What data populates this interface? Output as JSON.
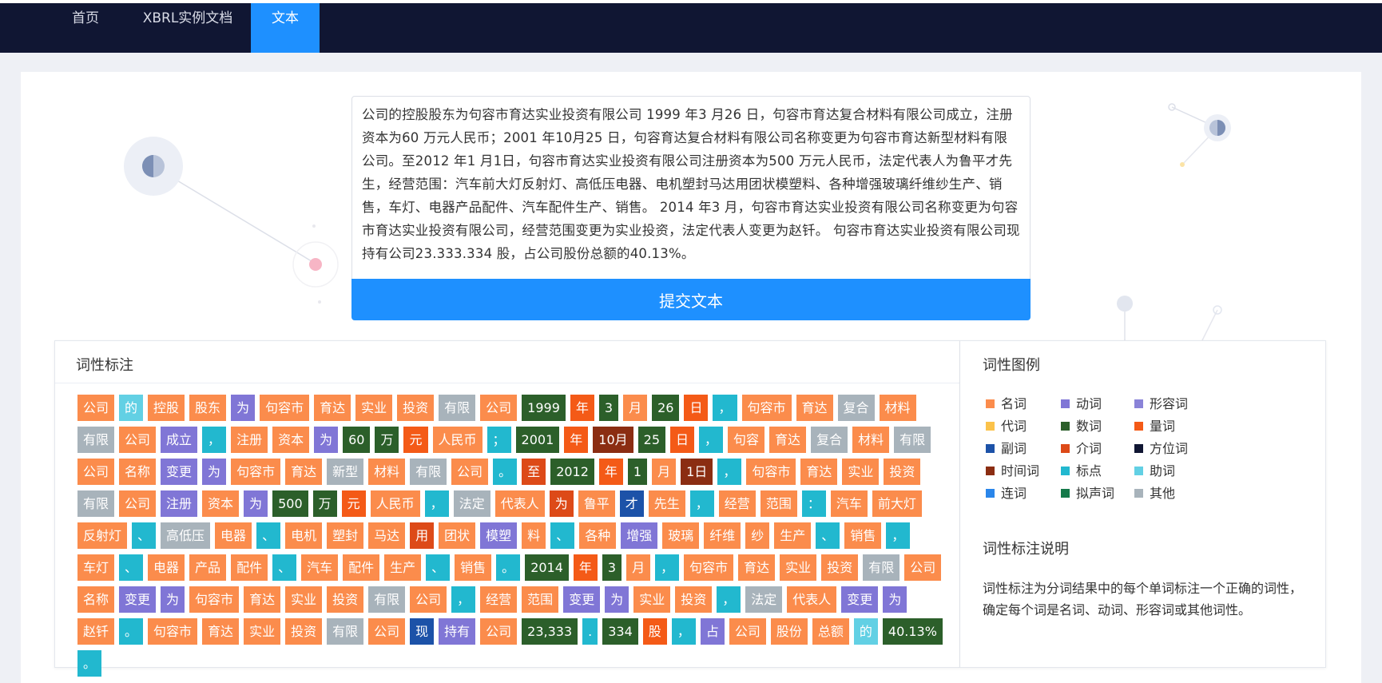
{
  "nav": {
    "items": [
      {
        "label": "首页"
      },
      {
        "label": "XBRL实例文档"
      },
      {
        "label": "文本"
      }
    ]
  },
  "input": {
    "text": "公司的控股股东为句容市育达实业投资有限公司 1999 年3 月26 日，句容市育达复合材料有限公司成立，注册资本为60 万元人民币；2001 年10月25 日，句容育达复合材料有限公司名称变更为句容市育达新型材料有限公司。至2012 年1 月1日，句容市育达实业投资有限公司注册资本为500 万元人民币，法定代表人为鲁平才先生，经营范围：汽车前大灯反射灯、高低压电器、电机塑封马达用团状模塑料、各种增强玻璃纤维纱生产、销售，车灯、电器产品配件、汽车配件生产、销售。 2014 年3 月，句容市育达实业投资有限公司名称变更为句容市育达实业投资有限公司，经营范围变更为实业投资，法定代表人变更为赵钎。 句容市育达实业投资有限公司现持有公司23.333.334 股，占公司股份总额的40.13%。"
  },
  "submit": {
    "label": "提交文本"
  },
  "pos_panel": {
    "title": "词性标注"
  },
  "legend_panel": {
    "title": "词性图例",
    "desc_title": "词性标注说明",
    "desc": "词性标注为分词结果中的每个单词标注一个正确的词性，确定每个词是名词、动词、形容词或其他词性。"
  },
  "colors": {
    "n": "#fb8c4c",
    "v": "#8076d6",
    "a": "#8a83d8",
    "r": "#fbc24a",
    "m": "#2c5f2a",
    "q": "#f45a17",
    "d": "#1c52a8",
    "p": "#dd4a18",
    "f": "#101633",
    "t": "#8b2d12",
    "w": "#22b8cf",
    "u": "#62d0e4",
    "c": "#2a86ea",
    "o": "#15794a",
    "x": "#a8b3bb"
  },
  "legend": [
    {
      "key": "n",
      "label": "名词"
    },
    {
      "key": "v",
      "label": "动词"
    },
    {
      "key": "a",
      "label": "形容词"
    },
    {
      "key": "r",
      "label": "代词"
    },
    {
      "key": "m",
      "label": "数词"
    },
    {
      "key": "q",
      "label": "量词"
    },
    {
      "key": "d",
      "label": "副词"
    },
    {
      "key": "p",
      "label": "介词"
    },
    {
      "key": "f",
      "label": "方位词"
    },
    {
      "key": "t",
      "label": "时间词"
    },
    {
      "key": "w",
      "label": "标点"
    },
    {
      "key": "u",
      "label": "助词"
    },
    {
      "key": "c",
      "label": "连词"
    },
    {
      "key": "o",
      "label": "拟声词"
    },
    {
      "key": "x",
      "label": "其他"
    }
  ],
  "tokens": [
    {
      "text": "公司",
      "pos": "n"
    },
    {
      "text": "的",
      "pos": "u"
    },
    {
      "text": "控股",
      "pos": "n"
    },
    {
      "text": "股东",
      "pos": "n"
    },
    {
      "text": "为",
      "pos": "v"
    },
    {
      "text": "句容市",
      "pos": "n"
    },
    {
      "text": "育达",
      "pos": "n"
    },
    {
      "text": "实业",
      "pos": "n"
    },
    {
      "text": "投资",
      "pos": "n"
    },
    {
      "text": "有限",
      "pos": "x"
    },
    {
      "text": "公司",
      "pos": "n"
    },
    {
      "text": "1999",
      "pos": "m"
    },
    {
      "text": "年",
      "pos": "q"
    },
    {
      "text": "3",
      "pos": "m"
    },
    {
      "text": "月",
      "pos": "n"
    },
    {
      "text": "26",
      "pos": "m"
    },
    {
      "text": "日",
      "pos": "q"
    },
    {
      "text": "，",
      "pos": "w"
    },
    {
      "text": "句容市",
      "pos": "n"
    },
    {
      "text": "育达",
      "pos": "n"
    },
    {
      "text": "复合",
      "pos": "x"
    },
    {
      "text": "材料",
      "pos": "n"
    },
    {
      "text": "有限",
      "pos": "x"
    },
    {
      "text": "公司",
      "pos": "n"
    },
    {
      "text": "成立",
      "pos": "v"
    },
    {
      "text": "，",
      "pos": "w"
    },
    {
      "text": "注册",
      "pos": "n"
    },
    {
      "text": "资本",
      "pos": "n"
    },
    {
      "text": "为",
      "pos": "v"
    },
    {
      "text": "60",
      "pos": "m"
    },
    {
      "text": "万",
      "pos": "m"
    },
    {
      "text": "元",
      "pos": "q"
    },
    {
      "text": "人民币",
      "pos": "n"
    },
    {
      "text": "；",
      "pos": "w"
    },
    {
      "text": "2001",
      "pos": "m"
    },
    {
      "text": "年",
      "pos": "q"
    },
    {
      "text": "10月",
      "pos": "t"
    },
    {
      "text": "25",
      "pos": "m"
    },
    {
      "text": "日",
      "pos": "q"
    },
    {
      "text": "，",
      "pos": "w"
    },
    {
      "text": "句容",
      "pos": "n"
    },
    {
      "text": "育达",
      "pos": "n"
    },
    {
      "text": "复合",
      "pos": "x"
    },
    {
      "text": "材料",
      "pos": "n"
    },
    {
      "text": "有限",
      "pos": "x"
    },
    {
      "text": "公司",
      "pos": "n"
    },
    {
      "text": "名称",
      "pos": "n"
    },
    {
      "text": "变更",
      "pos": "v"
    },
    {
      "text": "为",
      "pos": "v"
    },
    {
      "text": "句容市",
      "pos": "n"
    },
    {
      "text": "育达",
      "pos": "n"
    },
    {
      "text": "新型",
      "pos": "x"
    },
    {
      "text": "材料",
      "pos": "n"
    },
    {
      "text": "有限",
      "pos": "x"
    },
    {
      "text": "公司",
      "pos": "n"
    },
    {
      "text": "。",
      "pos": "w"
    },
    {
      "text": "至",
      "pos": "p"
    },
    {
      "text": "2012",
      "pos": "m"
    },
    {
      "text": "年",
      "pos": "q"
    },
    {
      "text": "1",
      "pos": "m"
    },
    {
      "text": "月",
      "pos": "n"
    },
    {
      "text": "1日",
      "pos": "t"
    },
    {
      "text": "，",
      "pos": "w"
    },
    {
      "text": "句容市",
      "pos": "n"
    },
    {
      "text": "育达",
      "pos": "n"
    },
    {
      "text": "实业",
      "pos": "n"
    },
    {
      "text": "投资",
      "pos": "n"
    },
    {
      "text": "有限",
      "pos": "x"
    },
    {
      "text": "公司",
      "pos": "n"
    },
    {
      "text": "注册",
      "pos": "v"
    },
    {
      "text": "资本",
      "pos": "n"
    },
    {
      "text": "为",
      "pos": "v"
    },
    {
      "text": "500",
      "pos": "m"
    },
    {
      "text": "万",
      "pos": "m"
    },
    {
      "text": "元",
      "pos": "q"
    },
    {
      "text": "人民币",
      "pos": "n"
    },
    {
      "text": "，",
      "pos": "w"
    },
    {
      "text": "法定",
      "pos": "x"
    },
    {
      "text": "代表人",
      "pos": "n"
    },
    {
      "text": "为",
      "pos": "p"
    },
    {
      "text": "鲁平",
      "pos": "n"
    },
    {
      "text": "才",
      "pos": "d"
    },
    {
      "text": "先生",
      "pos": "n"
    },
    {
      "text": "，",
      "pos": "w"
    },
    {
      "text": "经营",
      "pos": "n"
    },
    {
      "text": "范围",
      "pos": "n"
    },
    {
      "text": "：",
      "pos": "w"
    },
    {
      "text": "汽车",
      "pos": "n"
    },
    {
      "text": "前大灯",
      "pos": "n"
    },
    {
      "text": "反射灯",
      "pos": "n"
    },
    {
      "text": "、",
      "pos": "w"
    },
    {
      "text": "高低压",
      "pos": "x"
    },
    {
      "text": "电器",
      "pos": "n"
    },
    {
      "text": "、",
      "pos": "w"
    },
    {
      "text": "电机",
      "pos": "n"
    },
    {
      "text": "塑封",
      "pos": "n"
    },
    {
      "text": "马达",
      "pos": "n"
    },
    {
      "text": "用",
      "pos": "p"
    },
    {
      "text": "团状",
      "pos": "n"
    },
    {
      "text": "模塑",
      "pos": "v"
    },
    {
      "text": "料",
      "pos": "n"
    },
    {
      "text": "、",
      "pos": "w"
    },
    {
      "text": "各种",
      "pos": "n"
    },
    {
      "text": "增强",
      "pos": "v"
    },
    {
      "text": "玻璃",
      "pos": "n"
    },
    {
      "text": "纤维",
      "pos": "n"
    },
    {
      "text": "纱",
      "pos": "n"
    },
    {
      "text": "生产",
      "pos": "n"
    },
    {
      "text": "、",
      "pos": "w"
    },
    {
      "text": "销售",
      "pos": "n"
    },
    {
      "text": "，",
      "pos": "w"
    },
    {
      "text": "车灯",
      "pos": "n"
    },
    {
      "text": "、",
      "pos": "w"
    },
    {
      "text": "电器",
      "pos": "n"
    },
    {
      "text": "产品",
      "pos": "n"
    },
    {
      "text": "配件",
      "pos": "n"
    },
    {
      "text": "、",
      "pos": "w"
    },
    {
      "text": "汽车",
      "pos": "n"
    },
    {
      "text": "配件",
      "pos": "n"
    },
    {
      "text": "生产",
      "pos": "n"
    },
    {
      "text": "、",
      "pos": "w"
    },
    {
      "text": "销售",
      "pos": "n"
    },
    {
      "text": "。",
      "pos": "w"
    },
    {
      "text": "2014",
      "pos": "m"
    },
    {
      "text": "年",
      "pos": "q"
    },
    {
      "text": "3",
      "pos": "m"
    },
    {
      "text": "月",
      "pos": "n"
    },
    {
      "text": "，",
      "pos": "w"
    },
    {
      "text": "句容市",
      "pos": "n"
    },
    {
      "text": "育达",
      "pos": "n"
    },
    {
      "text": "实业",
      "pos": "n"
    },
    {
      "text": "投资",
      "pos": "n"
    },
    {
      "text": "有限",
      "pos": "x"
    },
    {
      "text": "公司",
      "pos": "n"
    },
    {
      "text": "名称",
      "pos": "n"
    },
    {
      "text": "变更",
      "pos": "v"
    },
    {
      "text": "为",
      "pos": "v"
    },
    {
      "text": "句容市",
      "pos": "n"
    },
    {
      "text": "育达",
      "pos": "n"
    },
    {
      "text": "实业",
      "pos": "n"
    },
    {
      "text": "投资",
      "pos": "n"
    },
    {
      "text": "有限",
      "pos": "x"
    },
    {
      "text": "公司",
      "pos": "n"
    },
    {
      "text": "，",
      "pos": "w"
    },
    {
      "text": "经营",
      "pos": "n"
    },
    {
      "text": "范围",
      "pos": "n"
    },
    {
      "text": "变更",
      "pos": "v"
    },
    {
      "text": "为",
      "pos": "v"
    },
    {
      "text": "实业",
      "pos": "n"
    },
    {
      "text": "投资",
      "pos": "n"
    },
    {
      "text": "，",
      "pos": "w"
    },
    {
      "text": "法定",
      "pos": "x"
    },
    {
      "text": "代表人",
      "pos": "n"
    },
    {
      "text": "变更",
      "pos": "v"
    },
    {
      "text": "为",
      "pos": "v"
    },
    {
      "text": "赵钎",
      "pos": "n"
    },
    {
      "text": "。",
      "pos": "w"
    },
    {
      "text": "句容市",
      "pos": "n"
    },
    {
      "text": "育达",
      "pos": "n"
    },
    {
      "text": "实业",
      "pos": "n"
    },
    {
      "text": "投资",
      "pos": "n"
    },
    {
      "text": "有限",
      "pos": "x"
    },
    {
      "text": "公司",
      "pos": "n"
    },
    {
      "text": "现",
      "pos": "d"
    },
    {
      "text": "持有",
      "pos": "v"
    },
    {
      "text": "公司",
      "pos": "n"
    },
    {
      "text": "23,333",
      "pos": "m"
    },
    {
      "text": ".",
      "pos": "w"
    },
    {
      "text": "334",
      "pos": "m"
    },
    {
      "text": "股",
      "pos": "q"
    },
    {
      "text": "，",
      "pos": "w"
    },
    {
      "text": "占",
      "pos": "v"
    },
    {
      "text": "公司",
      "pos": "n"
    },
    {
      "text": "股份",
      "pos": "n"
    },
    {
      "text": "总额",
      "pos": "n"
    },
    {
      "text": "的",
      "pos": "u"
    },
    {
      "text": "40.13%",
      "pos": "m"
    },
    {
      "text": "。",
      "pos": "w"
    }
  ]
}
